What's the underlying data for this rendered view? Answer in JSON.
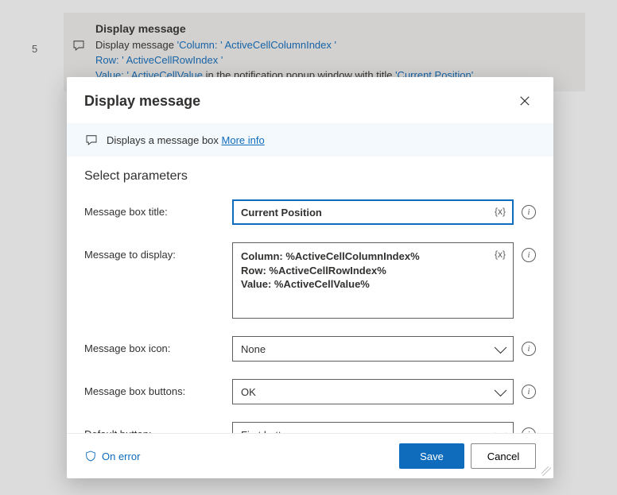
{
  "background": {
    "step_number": "5",
    "action_title": "Display message",
    "line1_prefix": "Display message ",
    "line1_q1": "'Column: '",
    "line1_var1": "   ActiveCellColumnIndex",
    "line1_q2": "   '",
    "line2_prefix": "Row: '",
    "line2_var": "   ActiveCellRowIndex",
    "line2_q": "   '",
    "line3_prefix": "Value: '",
    "line3_var": "   ActiveCellValue",
    "line3_after": "    in the notification popup window with title ",
    "line3_title": "'Current Position'",
    "line3_dot": "."
  },
  "modal": {
    "title": "Display message",
    "info_text": "Displays a message box ",
    "more_info": "More info",
    "section_header": "Select parameters",
    "labels": {
      "title": "Message box title:",
      "message": "Message to display:",
      "icon": "Message box icon:",
      "buttons": "Message box buttons:",
      "default_button": "Default button:"
    },
    "values": {
      "title": "Current Position",
      "message": "Column: %ActiveCellColumnIndex%\nRow: %ActiveCellRowIndex%\nValue: %ActiveCellValue%",
      "icon": "None",
      "buttons": "OK",
      "default_button": "First button"
    },
    "var_token": "{x}",
    "footer": {
      "on_error": "On error",
      "save": "Save",
      "cancel": "Cancel"
    }
  }
}
